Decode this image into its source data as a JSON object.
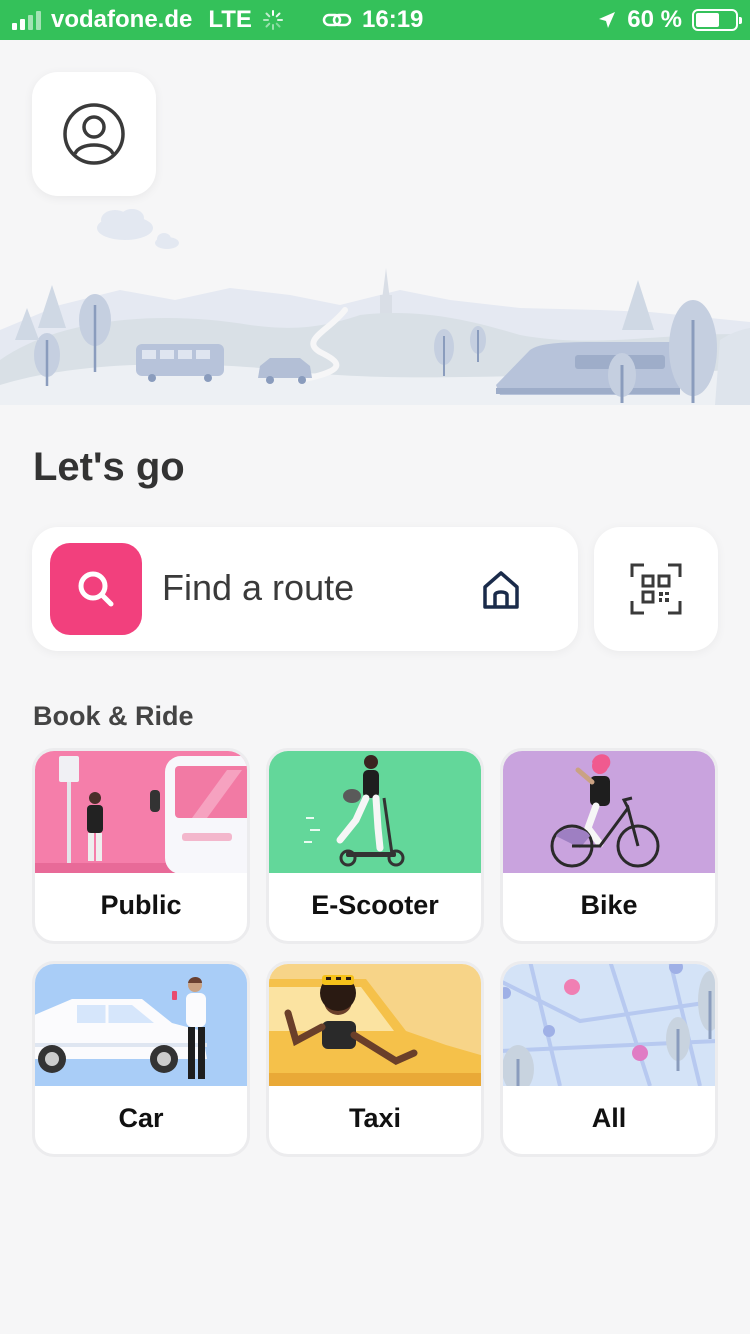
{
  "status_bar": {
    "carrier": "vodafone.de",
    "network": "LTE",
    "time": "16:19",
    "battery": "60 %",
    "battery_level": 0.6
  },
  "header": {
    "profile_icon": "user-circle-icon"
  },
  "main": {
    "headline": "Let's go",
    "search": {
      "label": "Find a route",
      "search_icon": "search-icon",
      "home_icon": "home-icon",
      "qr_icon": "qr-scan-icon"
    },
    "section_title": "Book & Ride",
    "tiles": [
      {
        "label": "Public",
        "color": "#f57eaa"
      },
      {
        "label": "E-Scooter",
        "color": "#63d79a"
      },
      {
        "label": "Bike",
        "color": "#c9a3de"
      },
      {
        "label": "Car",
        "color": "#a9cdf7"
      },
      {
        "label": "Taxi",
        "color": "#f7d488"
      },
      {
        "label": "All",
        "color": "#d4e3f7"
      }
    ]
  },
  "colors": {
    "status_bar": "#34c15a",
    "accent": "#f2407d",
    "background": "#f6f6f7"
  }
}
